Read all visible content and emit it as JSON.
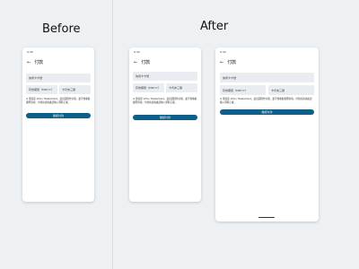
{
  "labels": {
    "before": "Before",
    "after": "After"
  },
  "screen": {
    "status_time": "9:36",
    "status_time_after": "9:40",
    "title": "付款",
    "card_number_placeholder": "信用卡卡號",
    "expiry_placeholder": "有效期限（MM/YY）",
    "cvv_placeholder": "卡背末三碼",
    "hint": "※ 僅接受 VISA / MasterCard，此頁面僅作示範，並不會收取實際款項，付款前請先確認輸入資料正確。",
    "pay_button": "確認付款"
  }
}
